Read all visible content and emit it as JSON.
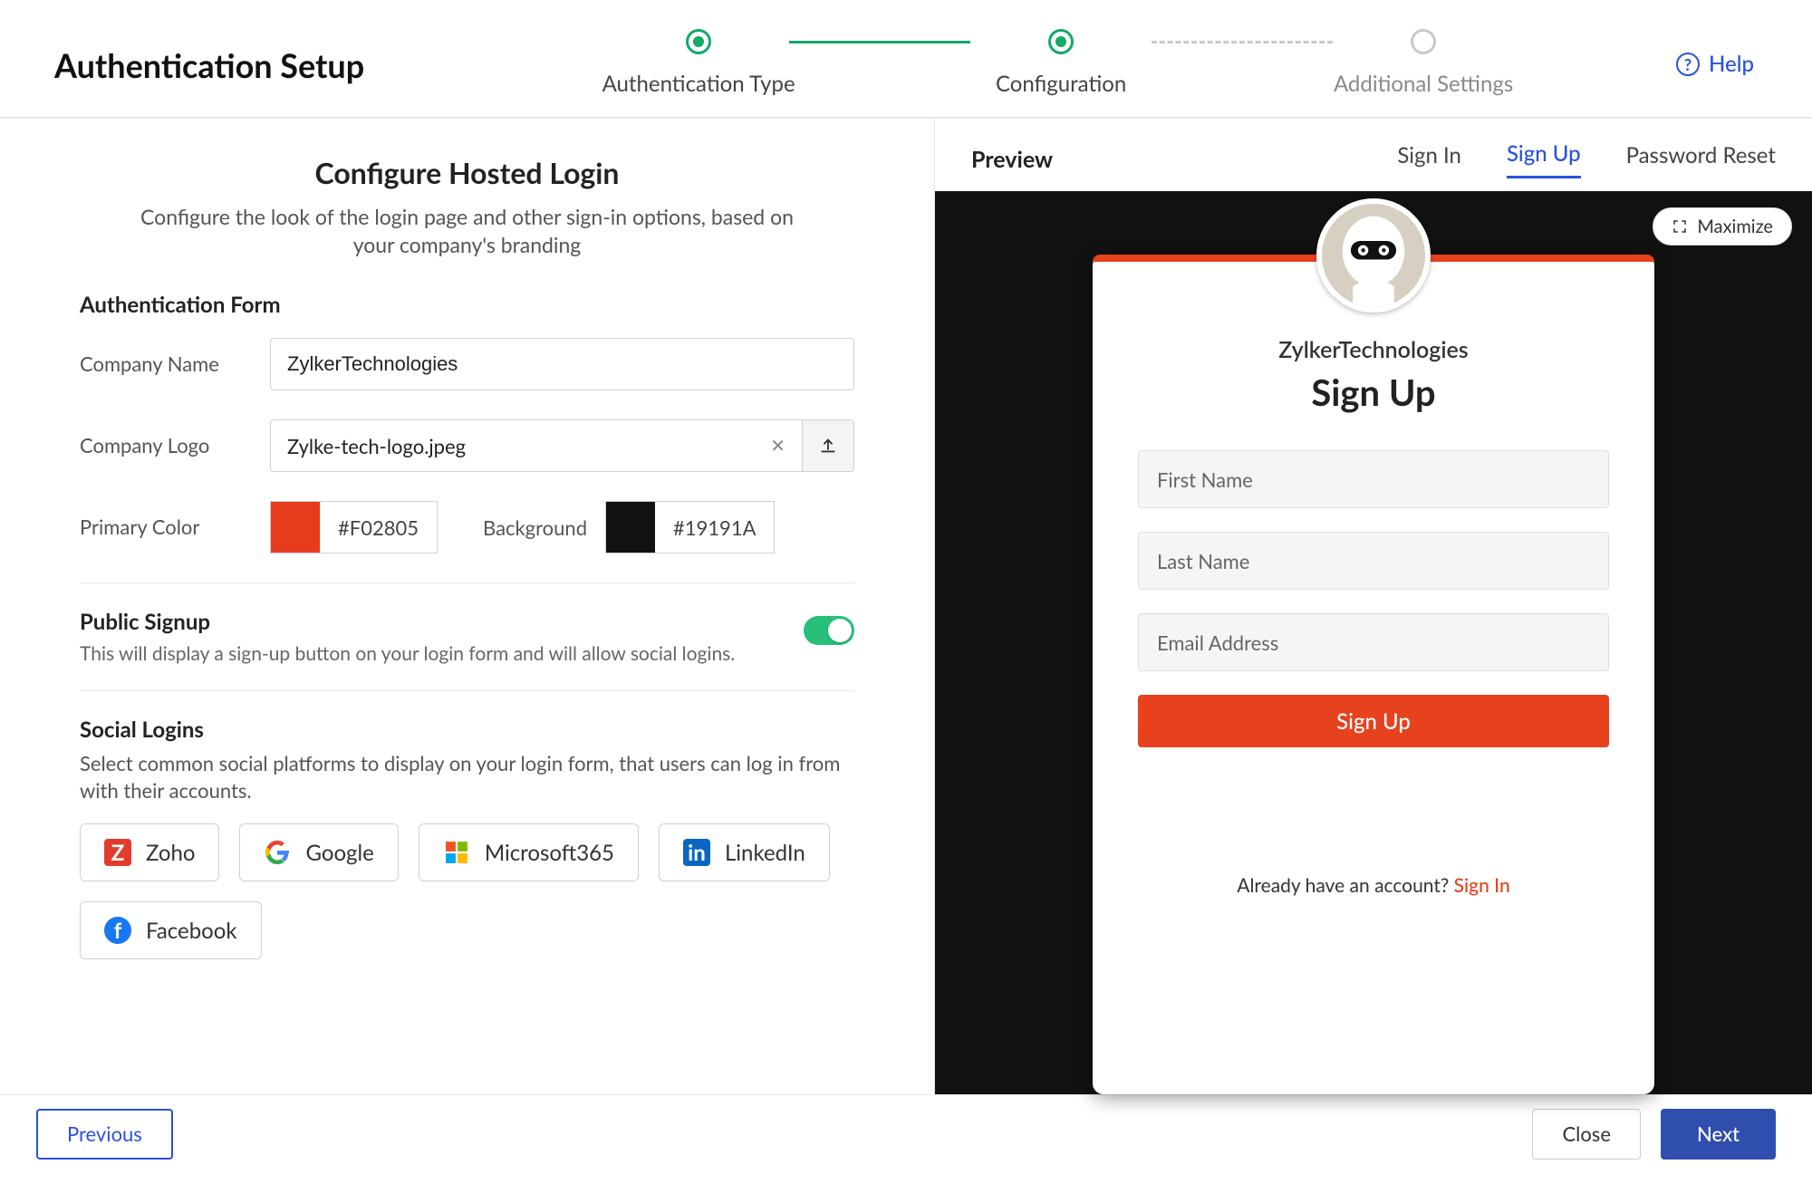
{
  "header": {
    "title": "Authentication Setup",
    "help": "Help"
  },
  "stepper": {
    "s1": "Authentication Type",
    "s2": "Configuration",
    "s3": "Additional Settings"
  },
  "config": {
    "title": "Configure Hosted Login",
    "subtitle": "Configure the look of the login page and other sign-in options, based on your company's branding",
    "auth_form_head": "Authentication Form",
    "company_name_label": "Company Name",
    "company_name_value": "ZylkerTechnologies",
    "company_logo_label": "Company Logo",
    "company_logo_value": "Zylke-tech-logo.jpeg",
    "primary_color_label": "Primary Color",
    "primary_color_value": "#F02805",
    "primary_color_swatch": "#E63C1D",
    "background_label": "Background",
    "background_value": "#19191A",
    "background_swatch": "#111",
    "public_signup_title": "Public Signup",
    "public_signup_desc": "This will display a sign-up button on your login form and will allow social logins.",
    "social_title": "Social Logins",
    "social_desc": "Select common social platforms to display on your login form, that users can log in from with their accounts.",
    "social": {
      "zoho": "Zoho",
      "google": "Google",
      "ms365": "Microsoft365",
      "linkedin": "LinkedIn",
      "facebook": "Facebook"
    }
  },
  "preview": {
    "title": "Preview",
    "tab_signin": "Sign In",
    "tab_signup": "Sign Up",
    "tab_pwreset": "Password Reset",
    "maximize": "Maximize",
    "card": {
      "company": "ZylkerTechnologies",
      "heading": "Sign Up",
      "first": "First Name",
      "last": "Last Name",
      "email": "Email Address",
      "button": "Sign Up",
      "already": "Already have an account? ",
      "signin_link": "Sign In",
      "accent": "#E6421E"
    }
  },
  "footer": {
    "prev": "Previous",
    "close": "Close",
    "next": "Next"
  }
}
